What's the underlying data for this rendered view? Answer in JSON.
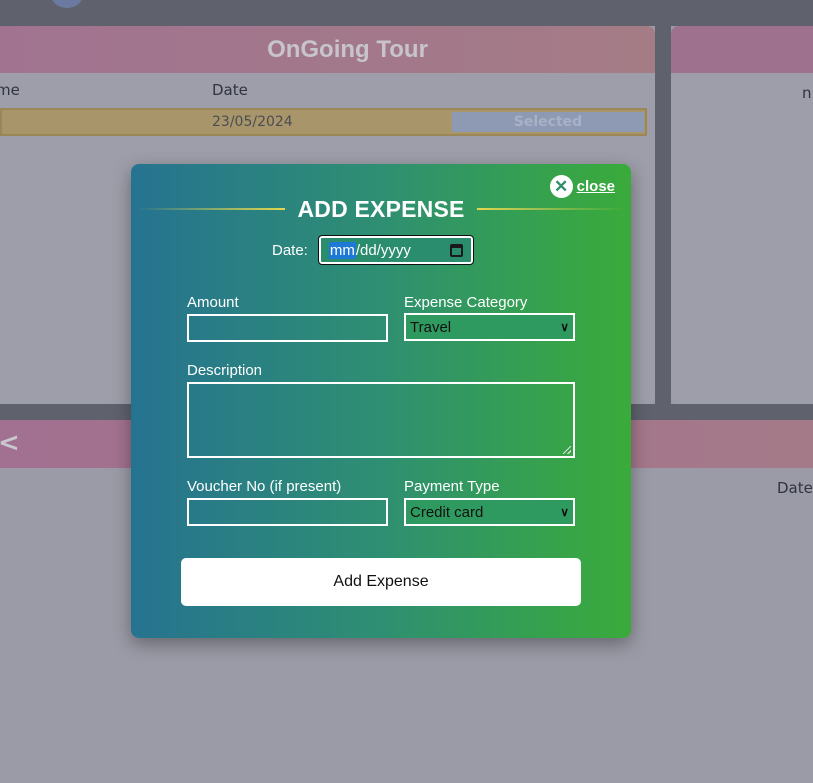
{
  "background": {
    "left_card": {
      "title": "OnGoing Tour",
      "columns": [
        "me",
        "Date"
      ],
      "row": {
        "date": "23/05/2024",
        "status": "Selected"
      }
    },
    "right_card": {
      "text": "n"
    },
    "bottom_band_glyph": "<",
    "bottom_date_label": "Date"
  },
  "modal": {
    "close_label": "close",
    "close_icon": "✕",
    "title": "ADD EXPENSE",
    "date": {
      "label": "Date:",
      "segment": "mm",
      "rest": "/dd/yyyy"
    },
    "amount": {
      "label": "Amount",
      "value": ""
    },
    "category": {
      "label": "Expense Category",
      "selected": "Travel"
    },
    "description": {
      "label": "Description",
      "value": ""
    },
    "voucher": {
      "label": "Voucher No (if present)",
      "value": ""
    },
    "payment": {
      "label": "Payment Type",
      "selected": "Credit card"
    },
    "submit_label": "Add Expense"
  },
  "colors": {
    "modal_gradient_start": "#267390",
    "modal_gradient_end": "#3aab3a",
    "title_accent": "#e2d650"
  }
}
